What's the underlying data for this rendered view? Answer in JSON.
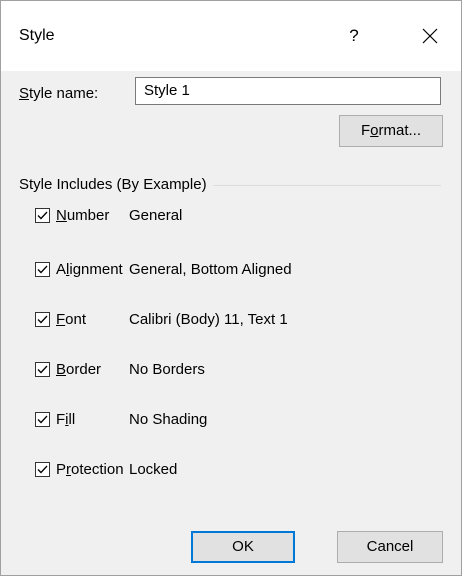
{
  "window": {
    "title": "Style",
    "help_label": "?"
  },
  "style_name": {
    "label_access_key": "S",
    "label_rest": "tyle name:",
    "value": "Style 1"
  },
  "format_button": {
    "pre": "F",
    "access_key": "o",
    "post": "rmat..."
  },
  "includes": {
    "title": "Style Includes (By Example)",
    "items": [
      {
        "pre": "",
        "key": "N",
        "post": "umber",
        "value": "General",
        "checked": true
      },
      {
        "pre": "A",
        "key": "l",
        "post": "ignment",
        "value": "General, Bottom Aligned",
        "checked": true
      },
      {
        "pre": "",
        "key": "F",
        "post": "ont",
        "value": "Calibri (Body) 11, Text 1",
        "checked": true
      },
      {
        "pre": "",
        "key": "B",
        "post": "order",
        "value": "No Borders",
        "checked": true
      },
      {
        "pre": "F",
        "key": "i",
        "post": "ll",
        "value": "No Shading",
        "checked": true
      },
      {
        "pre": "P",
        "key": "r",
        "post": "otection",
        "value": "Locked",
        "checked": true
      }
    ]
  },
  "buttons": {
    "ok": "OK",
    "cancel": "Cancel"
  },
  "icons": {
    "close": "close-icon",
    "checkmark": "checkmark-icon"
  }
}
